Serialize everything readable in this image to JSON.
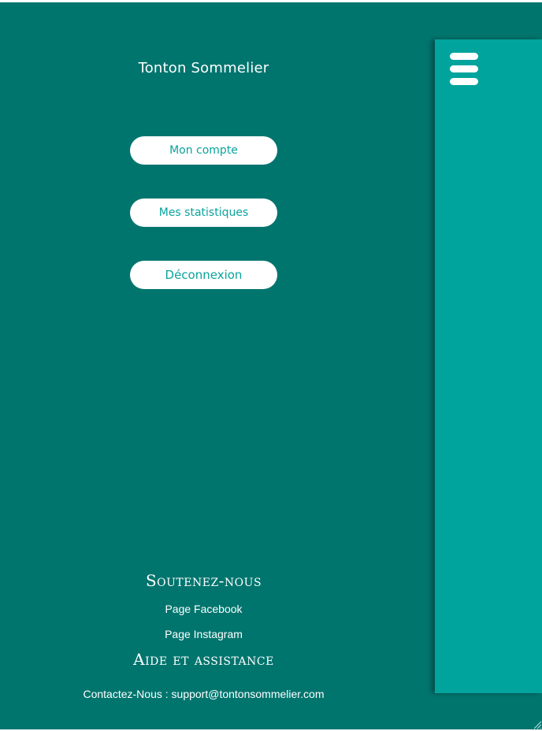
{
  "app": {
    "title": "Tonton Sommelier"
  },
  "menu": {
    "account_label": "Mon compte",
    "stats_label": "Mes statistiques",
    "logout_label": "Déconnexion"
  },
  "footer": {
    "support_heading": "Soutenez-nous",
    "facebook_label": "Page Facebook",
    "instagram_label": "Page Instagram",
    "help_heading": "Aide et assistance",
    "contact_text": "Contactez-Nous : support@tontonsommelier.com"
  },
  "icons": {
    "menu": "hamburger-menu-icon",
    "resize": "resize-grip-icon"
  },
  "colors": {
    "background": "#00756e",
    "panel": "#00a49d",
    "button_text": "#0aa39d",
    "button_bg": "#ffffff"
  }
}
